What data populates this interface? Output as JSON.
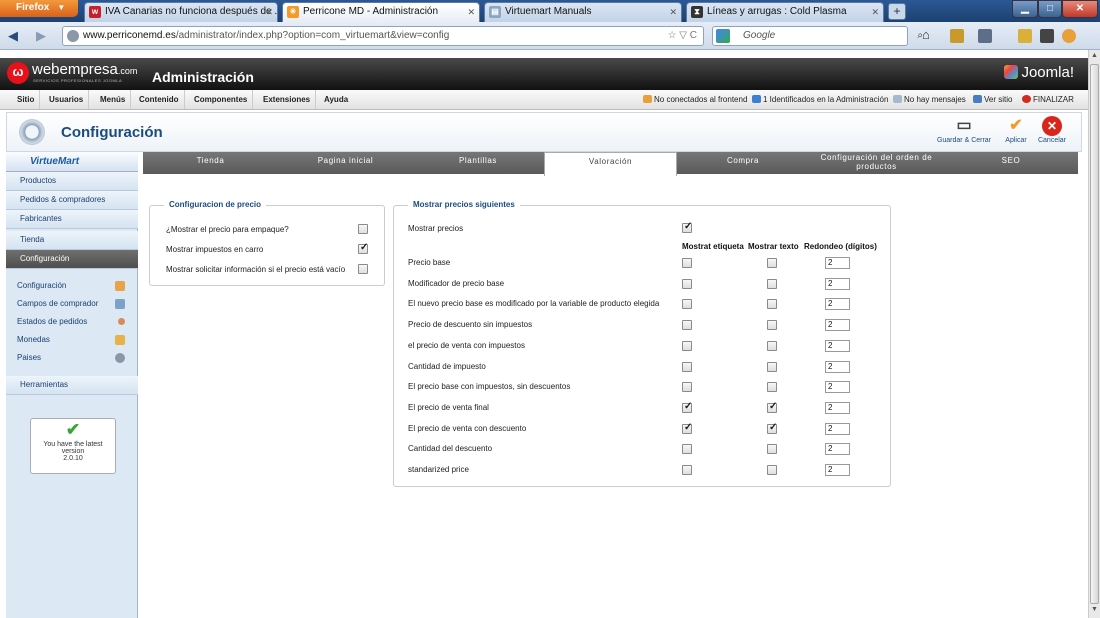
{
  "browser": {
    "menu_label": "Firefox",
    "tabs": [
      {
        "title": "IVA Canarias no funciona después de ..."
      },
      {
        "title": "Perricone MD - Administración"
      },
      {
        "title": "Virtuemart Manuals"
      },
      {
        "title": "Líneas y arrugas : Cold Plasma"
      }
    ],
    "url_domain": "www.perriconemd.es",
    "url_path": "/administrator/index.php?option=com_virtuemart&view=config",
    "search_placeholder": "Google"
  },
  "header": {
    "logo": "webempresa",
    "logo_suffix": ".com",
    "logo_tagline": "SERVICIOS PROFESIONALES JOOMLA",
    "title": "Administración",
    "cms_logo": "Joomla!"
  },
  "menu": {
    "items": [
      "Sitio",
      "Usuarios",
      "Menús",
      "Contenido",
      "Componentes",
      "Extensiones",
      "Ayuda"
    ],
    "status": {
      "frontend": "No conectados al frontend",
      "admin": "1 Identificados en la Administración",
      "messages": "No hay mensajes",
      "view_site": "Ver sitio",
      "logout": "FINALIZAR"
    }
  },
  "toolbar": {
    "title": "Configuración",
    "save_close": "Guardar & Cerrar",
    "apply": "Aplicar",
    "cancel": "Cancelar"
  },
  "sidebar": {
    "brand": "VirtueMart",
    "items": [
      "Productos",
      "Pedidos & compradores",
      "Fabricantes",
      "Tienda",
      "Configuración"
    ],
    "sub_items": [
      "Configuración",
      "Campos de comprador",
      "Estados de pedidos",
      "Monedas",
      "Paises"
    ],
    "tools": "Herramientas",
    "version": {
      "line1": "You have the latest",
      "line2": "version",
      "number": "2.0.10"
    }
  },
  "tabs": [
    {
      "label": "Tienda"
    },
    {
      "label": "Pagina inicial"
    },
    {
      "label": "Plantillas"
    },
    {
      "label": "Valoración",
      "active": true
    },
    {
      "label": "Compra"
    },
    {
      "label": "Configuración del orden de",
      "label2": "productos"
    },
    {
      "label": "SEO"
    }
  ],
  "price_config": {
    "legend": "Configuracion de precio",
    "rows": [
      {
        "label": "¿Mostrar el precio para empaque?",
        "checked": false
      },
      {
        "label": "Mostrar impuestos en carro",
        "checked": true
      },
      {
        "label": "Mostrar solicitar información si el precio está vacío",
        "checked": false
      }
    ]
  },
  "show_prices": {
    "legend": "Mostrar precios siguientes",
    "show_prices_label": "Mostrar precios",
    "show_prices_checked": true,
    "columns": [
      "Mostrat etiqueta",
      "Mostrar texto",
      "Redondeo (dígitos)"
    ],
    "rows": [
      {
        "label": "Precio base",
        "label_on": false,
        "text_on": false,
        "rounding": "2"
      },
      {
        "label": "Modificador de precio base",
        "label_on": false,
        "text_on": false,
        "rounding": "2"
      },
      {
        "label": "El nuevo precio base es modificado por la variable de producto elegida",
        "label_on": false,
        "text_on": false,
        "rounding": "2"
      },
      {
        "label": "Precio de descuento sin impuestos",
        "label_on": false,
        "text_on": false,
        "rounding": "2"
      },
      {
        "label": "el precio de venta con impuestos",
        "label_on": false,
        "text_on": false,
        "rounding": "2"
      },
      {
        "label": "Cantidad de impuesto",
        "label_on": false,
        "text_on": false,
        "rounding": "2"
      },
      {
        "label": "El precio base con impuestos, sin descuentos",
        "label_on": false,
        "text_on": false,
        "rounding": "2"
      },
      {
        "label": "El precio de venta final",
        "label_on": true,
        "text_on": true,
        "rounding": "2"
      },
      {
        "label": "El precio de venta con descuento",
        "label_on": true,
        "text_on": true,
        "rounding": "2"
      },
      {
        "label": "Cantidad del descuento",
        "label_on": false,
        "text_on": false,
        "rounding": "2"
      },
      {
        "label": "standarized price",
        "label_on": false,
        "text_on": false,
        "rounding": "2"
      }
    ]
  },
  "colors": {
    "accent": "#1b4c80",
    "header_bg": "#111111",
    "tab_bar": "#5a5a5a"
  }
}
